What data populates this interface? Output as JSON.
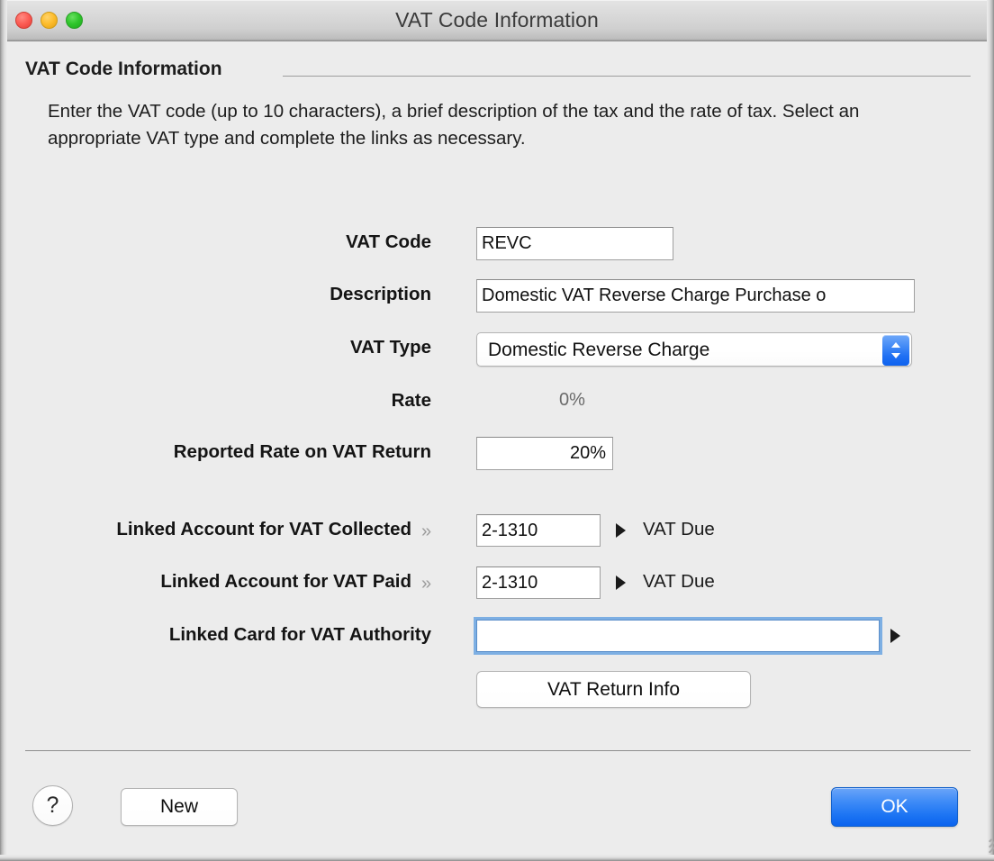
{
  "window": {
    "title": "VAT Code Information",
    "traffic_lights": [
      "close-button",
      "minimize-button",
      "zoom-button"
    ]
  },
  "group": {
    "title": "VAT Code Information",
    "instructions": "Enter the VAT code (up to 10 characters), a brief description of the tax and the rate of tax.  Select an appropriate VAT type and complete the links as necessary."
  },
  "form": {
    "vat_code": {
      "label": "VAT Code",
      "value": "REVC",
      "placeholder": ""
    },
    "description": {
      "label": "Description",
      "value": "Domestic VAT Reverse Charge Purchase o",
      "placeholder": ""
    },
    "vat_type": {
      "label": "VAT Type",
      "value": "Domestic Reverse Charge"
    },
    "rate": {
      "label": "Rate",
      "value": "0%"
    },
    "reported_rate": {
      "label": "Reported Rate on VAT Return",
      "value": "20%",
      "placeholder": ""
    },
    "linked_collected": {
      "label": "Linked Account for VAT Collected",
      "zoom_glyph": "»",
      "value": "2-1310",
      "linked_name": "VAT Due"
    },
    "linked_paid": {
      "label": "Linked Account for VAT Paid",
      "zoom_glyph": "»",
      "value": "2-1310",
      "linked_name": "VAT Due"
    },
    "linked_card": {
      "label": "Linked Card for VAT Authority",
      "value": "",
      "placeholder": ""
    },
    "vat_return_info_button": "VAT Return Info"
  },
  "footer": {
    "help_label": "?",
    "new_label": "New",
    "ok_label": "OK"
  },
  "colors": {
    "window_bg": "#ececec",
    "accent_blue": "#1c74f3",
    "focus_ring": "#6aa4e2",
    "label_text": "#141414",
    "readonly_text": "#6a6a6a",
    "chevron_gray": "#9c9c9c"
  }
}
